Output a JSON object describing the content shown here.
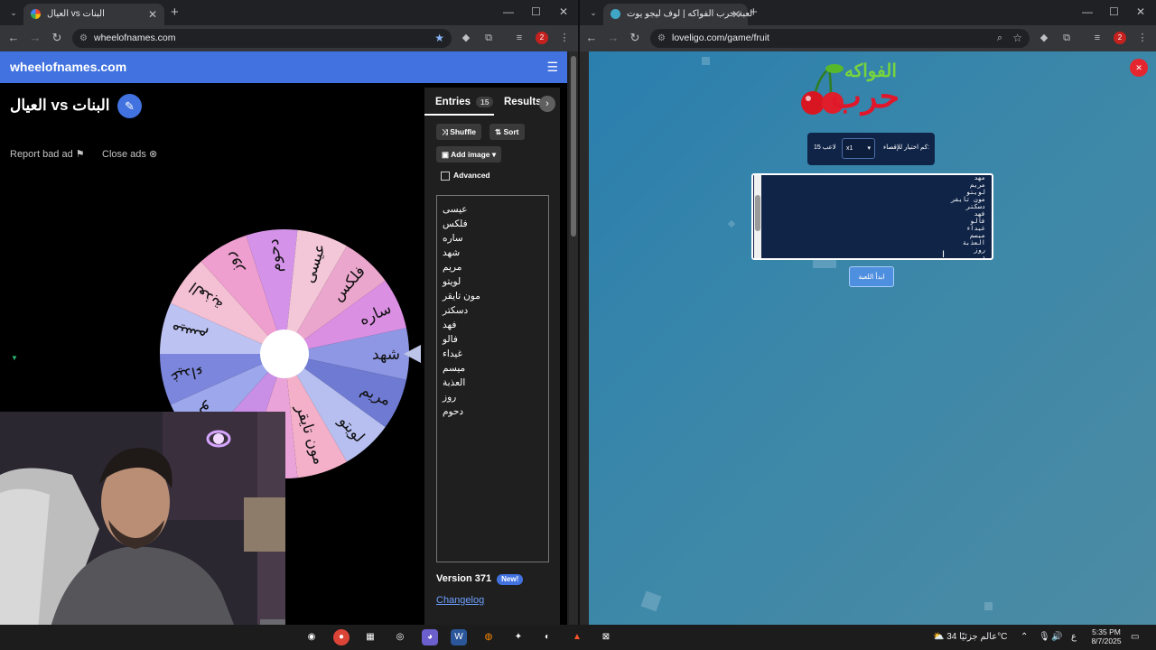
{
  "left_browser": {
    "tab_title": "العيال vs البنات",
    "url": "wheelofnames.com"
  },
  "right_browser": {
    "tab_title": "لعبة حرب الفواكه | لوف ليجو يوت",
    "url": "loveligo.com/game/fruit"
  },
  "wof": {
    "brand": "wheelofnames.com",
    "title": "البنات vs العيال",
    "report_ad": "Report bad ad",
    "close_ads": "Close ads",
    "tabs": {
      "entries": "Entries",
      "entries_count": "15",
      "results": "Results"
    },
    "buttons": {
      "shuffle": "Shuffle",
      "sort": "Sort",
      "add_image": "Add image"
    },
    "advanced_label": "Advanced",
    "entries": [
      "عيسى",
      "فلكس",
      "ساره",
      "شهد",
      "مريم",
      "لويتو",
      "مون تايقر",
      "دسكتر",
      "فهد",
      "فالو",
      "غيداء",
      "ميسم",
      "العذبة",
      "روز",
      "دحوم"
    ],
    "version": "Version 371",
    "new_badge": "New!",
    "changelog": "Changelog",
    "wheel_labels": [
      "شهد",
      "مريم",
      "لويتو",
      "مون تايقر",
      "دسكتر",
      "فهد",
      "فالو",
      "غيداء",
      "ميسم",
      "العذبة",
      "روز",
      "دحوم",
      "عيسى",
      "فلكس",
      "ساره"
    ],
    "wheel_colors": [
      "#8e97e3",
      "#6f7ad2",
      "#b6bff0",
      "#f3b0c8",
      "#eaa3d8",
      "#c98ee6",
      "#9da7ec",
      "#7c86dc",
      "#bcc2f2",
      "#f4c0d3",
      "#ef9fcf",
      "#d493e8",
      "#f3c7d7",
      "#eba6cd",
      "#da8fe3"
    ]
  },
  "fruit": {
    "logo_top": "الفواكه",
    "logo_bottom": "حرب",
    "players_label": "كم اختيار للإقصاء:",
    "multiplier": "x1",
    "players_count": "15 لاعب",
    "names": [
      "مهد",
      "مريم",
      "لويتو",
      "مون تايقر",
      "دسكتر",
      "فهد",
      "فالو",
      "غيداء",
      "ميسم",
      "العذبة",
      "روز",
      "د"
    ],
    "start_button": "ابدأ اللعبة"
  },
  "taskbar": {
    "weather": "عالم جزئيًا 34°C",
    "lang": "ع",
    "time": "5:35 PM",
    "date": "8/7/2025"
  }
}
